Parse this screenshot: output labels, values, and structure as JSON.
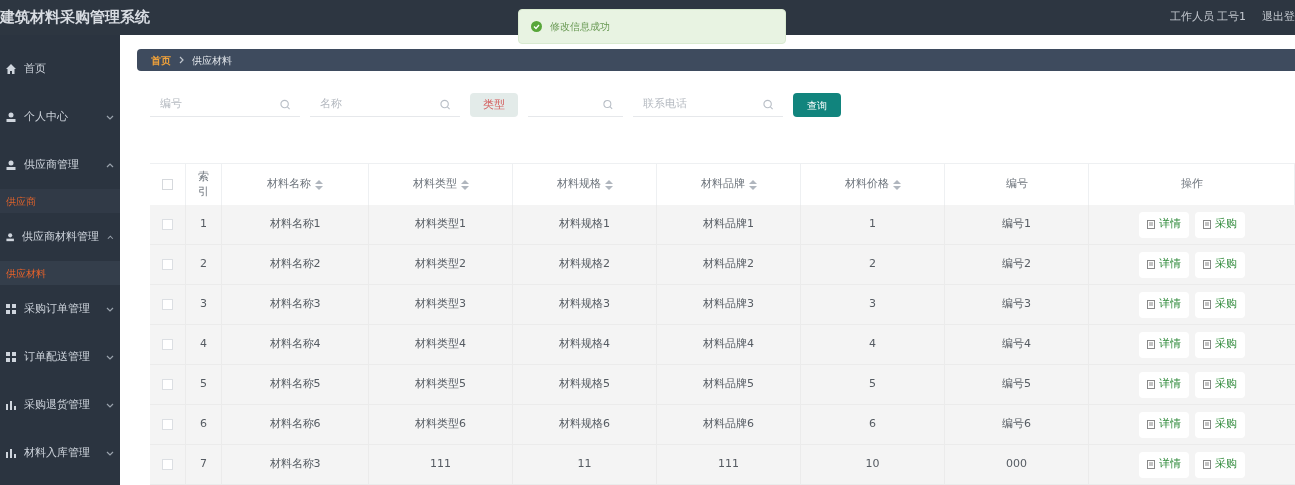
{
  "header": {
    "title": "建筑材料采购管理系统",
    "user": "工作人员 工号1",
    "logout": "退出登"
  },
  "toast": {
    "message": "修改信息成功"
  },
  "sidebar": {
    "items": [
      {
        "label": "首页"
      },
      {
        "label": "个人中心"
      },
      {
        "label": "供应商管理",
        "expanded": true,
        "children": [
          {
            "label": "供应商",
            "selected": false
          }
        ]
      },
      {
        "label": "供应商材料管理",
        "expanded": true,
        "children": [
          {
            "label": "供应材料",
            "selected": true
          }
        ]
      },
      {
        "label": "采购订单管理"
      },
      {
        "label": "订单配送管理"
      },
      {
        "label": "采购退货管理"
      },
      {
        "label": "材料入库管理"
      }
    ]
  },
  "breadcrumb": [
    "首页",
    "供应材料"
  ],
  "search": {
    "fields": [
      {
        "kind": "input",
        "placeholder": "编号"
      },
      {
        "kind": "input",
        "placeholder": "名称"
      },
      {
        "kind": "select",
        "placeholder": "类型"
      },
      {
        "kind": "input"
      },
      {
        "kind": "input",
        "placeholder": "联系电话"
      }
    ],
    "button": "查询"
  },
  "table": {
    "all_checked": false,
    "columns": [
      {
        "label": "索引",
        "sortable": false
      },
      {
        "label": "材料名称",
        "sortable": true
      },
      {
        "label": "材料类型",
        "sortable": true
      },
      {
        "label": "材料规格",
        "sortable": true
      },
      {
        "label": "材料品牌",
        "sortable": true
      },
      {
        "label": "材料价格",
        "sortable": true
      },
      {
        "label": "编号",
        "sortable": false
      },
      {
        "label": "操作",
        "sortable": false
      }
    ],
    "rows": [
      {
        "checked": false,
        "cells": [
          "1",
          "材料名称1",
          "材料类型1",
          "材料规格1",
          "材料品牌1",
          "1",
          "编号1"
        ],
        "actions": [
          "详情",
          "采购"
        ]
      },
      {
        "checked": false,
        "cells": [
          "2",
          "材料名称2",
          "材料类型2",
          "材料规格2",
          "材料品牌2",
          "2",
          "编号2"
        ],
        "actions": [
          "详情",
          "采购"
        ]
      },
      {
        "checked": false,
        "cells": [
          "3",
          "材料名称3",
          "材料类型3",
          "材料规格3",
          "材料品牌3",
          "3",
          "编号3"
        ],
        "actions": [
          "详情",
          "采购"
        ]
      },
      {
        "checked": false,
        "cells": [
          "4",
          "材料名称4",
          "材料类型4",
          "材料规格4",
          "材料品牌4",
          "4",
          "编号4"
        ],
        "actions": [
          "详情",
          "采购"
        ]
      },
      {
        "checked": false,
        "cells": [
          "5",
          "材料名称5",
          "材料类型5",
          "材料规格5",
          "材料品牌5",
          "5",
          "编号5"
        ],
        "actions": [
          "详情",
          "采购"
        ]
      },
      {
        "checked": false,
        "cells": [
          "6",
          "材料名称6",
          "材料类型6",
          "材料规格6",
          "材料品牌6",
          "6",
          "编号6"
        ],
        "actions": [
          "详情",
          "采购"
        ]
      },
      {
        "checked": false,
        "cells": [
          "7",
          "材料名称3",
          "111",
          "11",
          "111",
          "10",
          "000"
        ],
        "actions": [
          "详情",
          "采购"
        ]
      }
    ]
  }
}
